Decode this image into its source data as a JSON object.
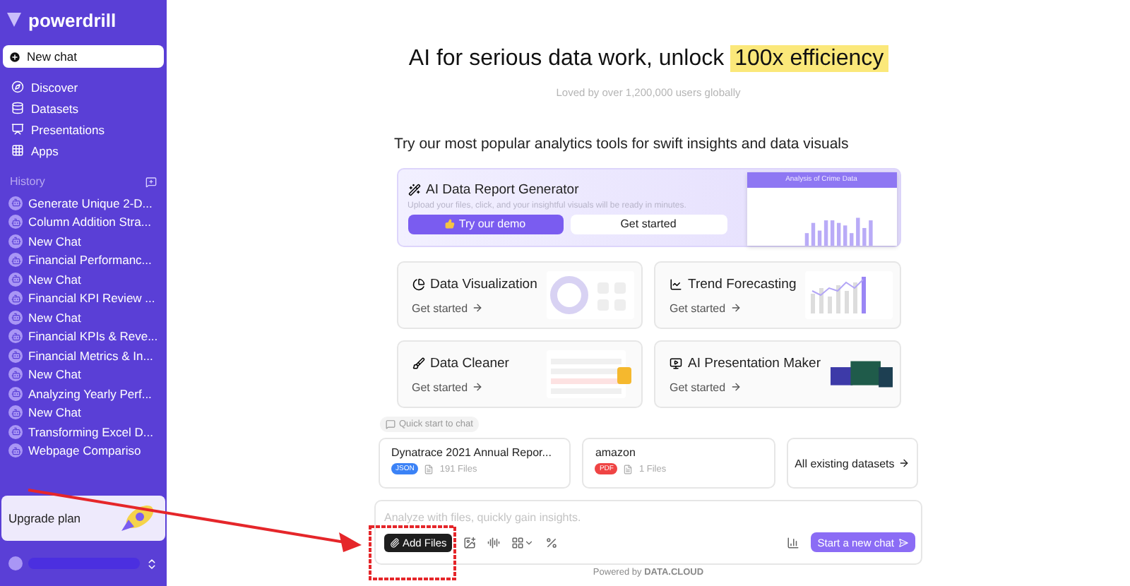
{
  "sidebar": {
    "logo": "powerdrill",
    "new_chat": "New chat",
    "nav": [
      {
        "label": "Discover",
        "kind": "compass"
      },
      {
        "label": "Datasets",
        "kind": "database"
      },
      {
        "label": "Presentations",
        "kind": "presentation"
      },
      {
        "label": "Apps",
        "kind": "grid"
      }
    ],
    "history_title": "History",
    "history": [
      "Generate Unique 2-D...",
      "Column Addition Stra...",
      "New Chat",
      "Financial Performanc...",
      "New Chat",
      "Financial KPI Review ...",
      "New Chat",
      "Financial KPIs & Reve...",
      "Financial Metrics & In...",
      "New Chat",
      "Analyzing Yearly Perf...",
      "New Chat",
      "Transforming Excel D...",
      "Webpage Compariso"
    ],
    "upgrade": "Upgrade plan"
  },
  "main": {
    "headline": "AI for serious data work, unlock",
    "headline_highlight": "100x efficiency",
    "subtitle": "Loved by over 1,200,000 users globally",
    "section_title": "Try our most popular analytics tools for swift insights and data visuals",
    "featured": {
      "title": "AI Data Report Generator",
      "description": "Upload your files, click, and your insightful visuals will be ready in minutes.",
      "primary": "Try our demo",
      "secondary": "Get started",
      "preview_title": "Analysis of Crime Data"
    },
    "tools": [
      {
        "title": "Data Visualization",
        "action": "Get started",
        "kind": "donut"
      },
      {
        "title": "Trend Forecasting",
        "action": "Get started",
        "kind": "trend"
      },
      {
        "title": "Data Cleaner",
        "action": "Get started",
        "kind": "table"
      },
      {
        "title": "AI Presentation Maker",
        "action": "Get started",
        "kind": "slides"
      }
    ],
    "quick_start": "Quick start to chat",
    "datasets": [
      {
        "name": "Dynatrace 2021 Annual Repor...",
        "type": "JSON",
        "color": "#3b82f6",
        "files": "191 Files"
      },
      {
        "name": "amazon",
        "type": "PDF",
        "color": "#ef4444",
        "files": "1 Files"
      }
    ],
    "all_datasets": "All existing datasets",
    "input": {
      "placeholder": "Analyze with files, quickly gain insights.",
      "add_files": "Add Files",
      "send": "Start a new chat"
    },
    "footer_prefix": "Powered by",
    "footer_brand": "DATA.CLOUD"
  }
}
